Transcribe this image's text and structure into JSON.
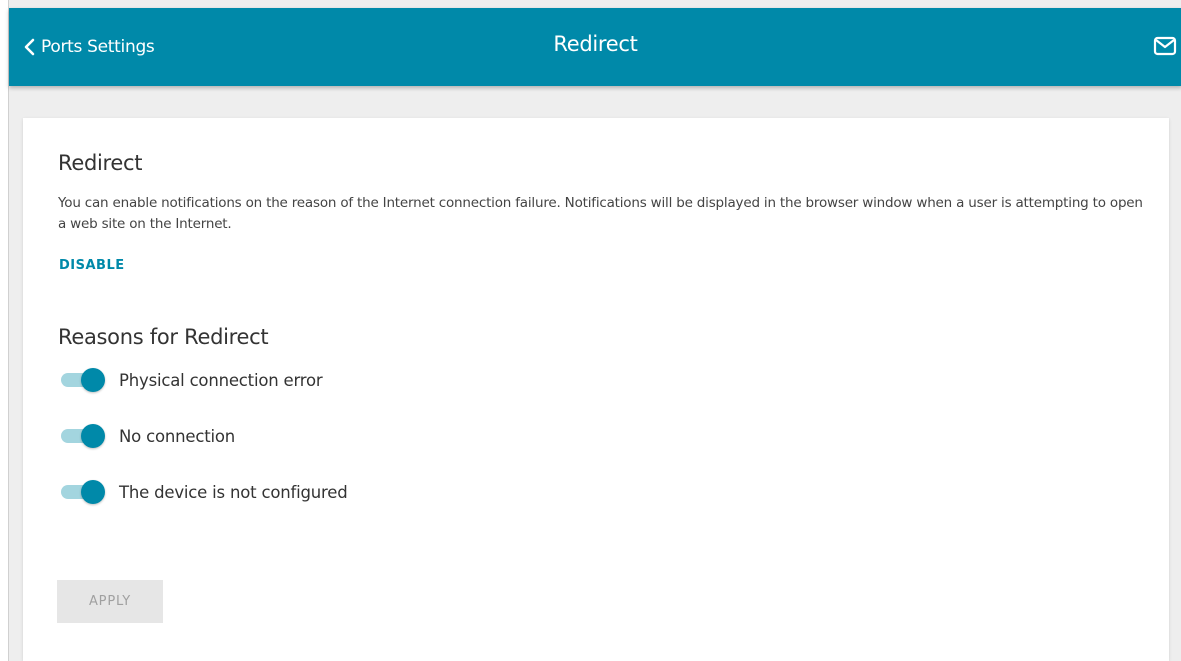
{
  "header": {
    "back_label": "Ports Settings",
    "title": "Redirect",
    "mail_icon": "mail-icon"
  },
  "redirect_section": {
    "heading": "Redirect",
    "description": "You can enable notifications on the reason of the Internet connection failure. Notifications will be displayed in the browser window when a user is attempting to open a web site on the Internet.",
    "disable_label": "DISABLE"
  },
  "reasons_section": {
    "heading": "Reasons for Redirect",
    "toggles": [
      {
        "label": "Physical connection error",
        "enabled": true
      },
      {
        "label": "No connection",
        "enabled": true
      },
      {
        "label": "The device is not configured",
        "enabled": true
      }
    ]
  },
  "apply_label": "APPLY",
  "colors": {
    "accent": "#0089a9",
    "track": "#a3d5df"
  }
}
